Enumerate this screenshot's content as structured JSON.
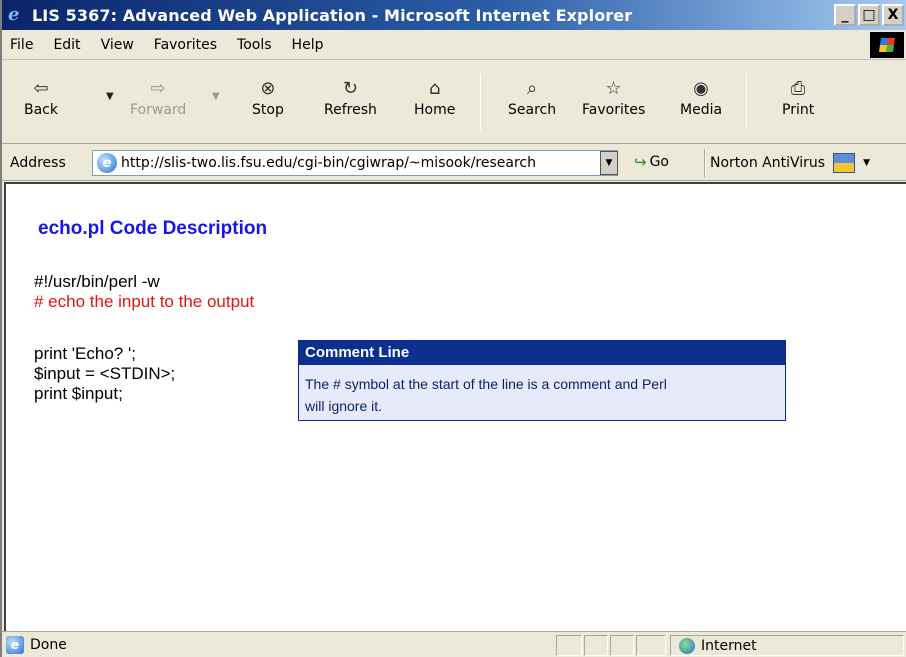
{
  "window": {
    "title": "LIS 5367: Advanced Web Application - Microsoft Internet Explorer",
    "minimize": "_",
    "maximize": "□",
    "close": "X"
  },
  "menu": [
    "File",
    "Edit",
    "View",
    "Favorites",
    "Tools",
    "Help"
  ],
  "toolbar": {
    "back": "Back",
    "forward": "Forward",
    "stop": "Stop",
    "refresh": "Refresh",
    "home": "Home",
    "search": "Search",
    "favorites": "Favorites",
    "media": "Media",
    "print": "Print"
  },
  "address": {
    "label": "Address",
    "url": "http://slis-two.lis.fsu.edu/cgi-bin/cgiwrap/~misook/research",
    "go": "Go",
    "norton": "Norton AntiVirus"
  },
  "page": {
    "heading": "echo.pl Code Description",
    "code_line1": "#!/usr/bin/perl -w",
    "code_line2": "# echo the input to the output",
    "code_line3": "print 'Echo? ';",
    "code_line4": "$input = <STDIN>;",
    "code_line5": "print $input;",
    "tooltip_title": "Comment Line",
    "tooltip_line1": "The # symbol at the start of the line is a comment and Perl",
    "tooltip_line2": "will ignore it."
  },
  "status": {
    "text": "Done",
    "zone": "Internet"
  },
  "colors": {
    "heading": "#1616e6",
    "comment": "#e2140f",
    "tooltip_header": "#0a2f8f",
    "tooltip_bg": "#e6eafb"
  },
  "icons": {
    "back": "left-arrow-icon",
    "forward": "right-arrow-icon",
    "stop": "stop-icon",
    "refresh": "refresh-icon",
    "home": "home-icon",
    "search": "magnifier-icon",
    "favorites": "star-folder-icon",
    "media": "media-icon",
    "print": "printer-icon"
  }
}
